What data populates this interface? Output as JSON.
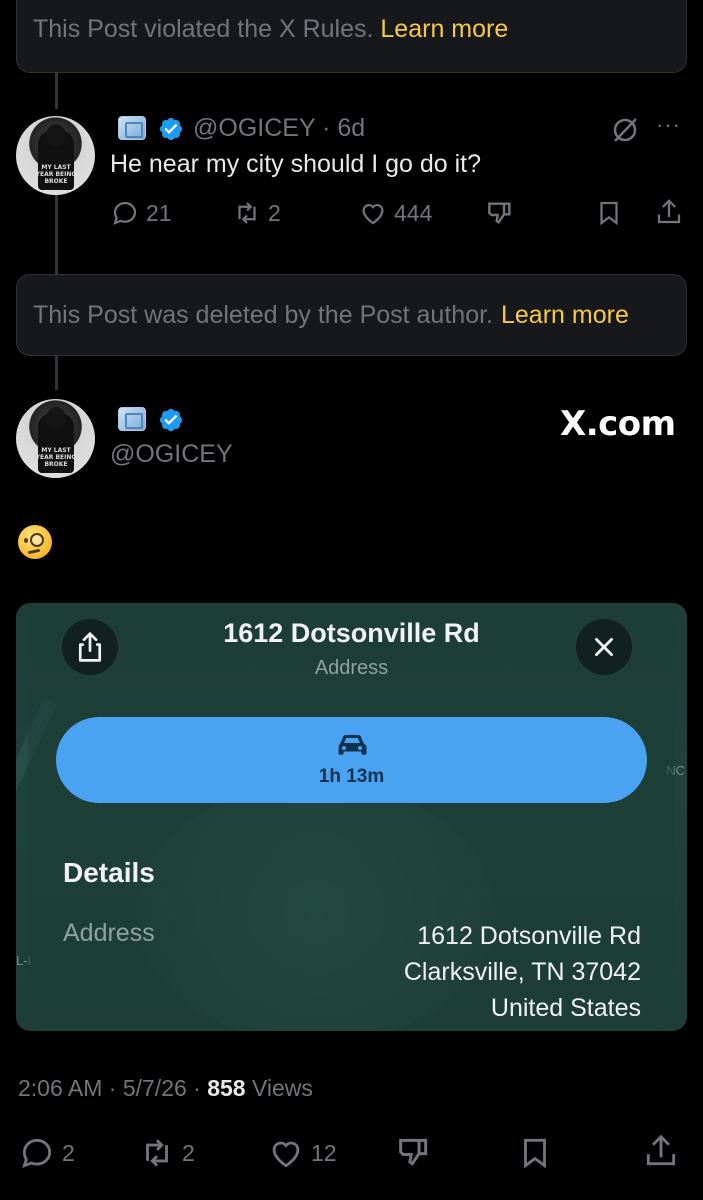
{
  "notices": {
    "top_text": "This Post violated the X Rules.",
    "top_link": "Learn more",
    "deleted_text": "This Post was deleted by the Post author.",
    "deleted_link": "Learn more"
  },
  "reply_post": {
    "avatar_text": "MY LAST YEAR BEING BROKE",
    "handle": "@OGICEY",
    "time": "· 6d",
    "text": "He near my city should I go do it?",
    "replies": "21",
    "reposts": "2",
    "likes": "444"
  },
  "main_post": {
    "handle": "@OGICEY",
    "source": "X.com",
    "emoji": "face-with-monocle",
    "timestamp": "2:06 AM · 5/7/26 · ",
    "views_count": "858",
    "views_label": " Views",
    "replies": "2",
    "reposts": "2",
    "likes": "12"
  },
  "map_card": {
    "title": "1612 Dotsonville Rd",
    "subtitle": "Address",
    "drive_time": "1h 13m",
    "details_heading": "Details",
    "address_label": "Address",
    "address_line1": "1612 Dotsonville Rd",
    "address_line2": "Clarksville, TN  37042",
    "address_line3": "United States",
    "edge_text_right": "NC",
    "edge_text_left": "L-I"
  },
  "colors": {
    "background": "#000000",
    "text_primary": "#e7e9ea",
    "text_secondary": "#71767b",
    "verified_blue": "#1d9bf0",
    "link_yellow": "#f7c948",
    "drive_button": "#4aa3f0"
  }
}
